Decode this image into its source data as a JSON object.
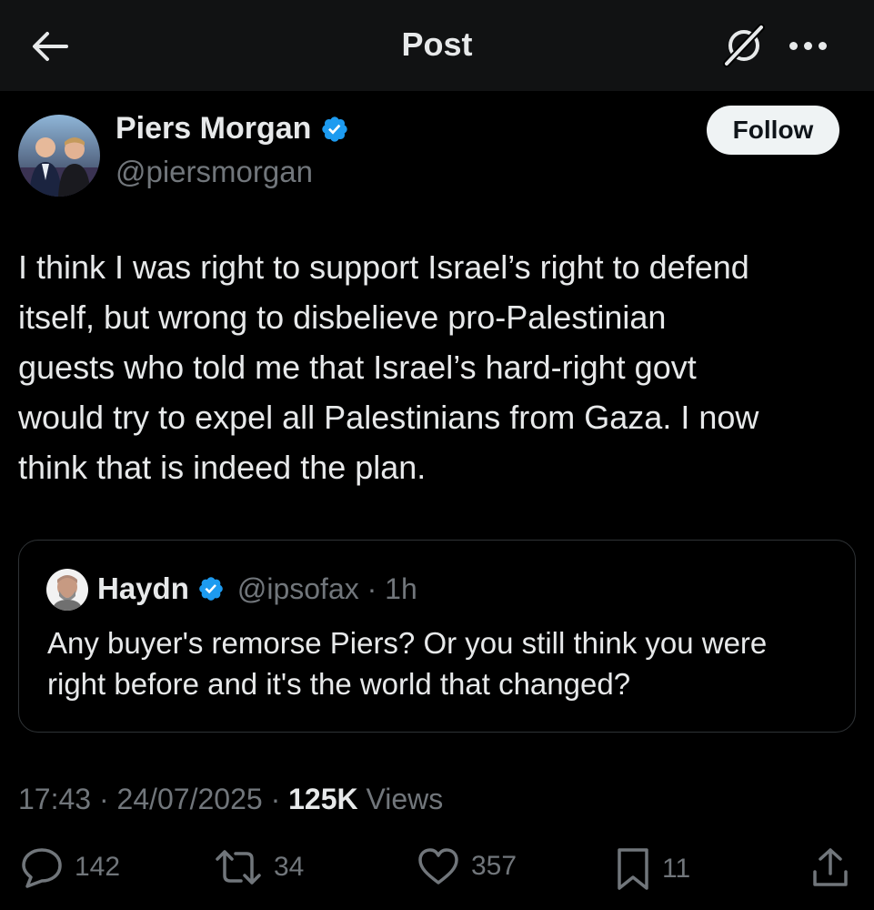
{
  "header": {
    "title": "Post",
    "back_icon": "arrow-left-icon",
    "grok_icon": "grok-icon",
    "more_icon": "more-horizontal-icon"
  },
  "post": {
    "author": {
      "name": "Piers Morgan",
      "handle": "@piersmorgan",
      "verified": true,
      "verified_color": "#1d9bf0"
    },
    "follow_label": "Follow",
    "text_lines": [
      "I think I was right to support Israel’s right to defend",
      "itself, but wrong to disbelieve pro-Palestinian",
      "guests who told me that Israel’s hard-right govt",
      "would try to expel all Palestinians from Gaza. I now",
      "think that is indeed the plan."
    ],
    "quoted": {
      "name": "Haydn",
      "handle_time": "@ipsofax · 1h",
      "verified": true,
      "text_lines": [
        "Any buyer's remorse Piers? Or you still think you were",
        "right before and it's the world that changed?"
      ]
    },
    "timestamp": "17:43 · 24/07/2025 · ",
    "views_count": "125K",
    "views_label": " Views",
    "actions": {
      "replies": "142",
      "reposts": "34",
      "likes": "357",
      "bookmarks": "11"
    }
  },
  "colors": {
    "background": "#000000",
    "header_bg": "#111213",
    "text_primary": "#e7e9ea",
    "text_secondary": "#71767b",
    "border": "#2f3336",
    "verified_blue": "#1d9bf0"
  }
}
